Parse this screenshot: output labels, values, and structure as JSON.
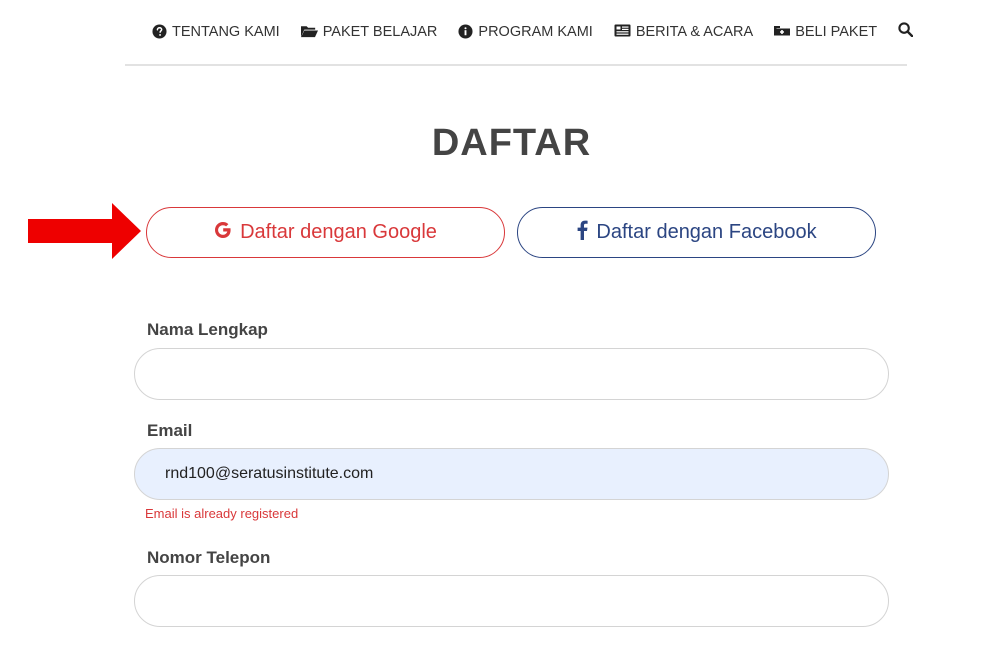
{
  "nav": {
    "items": [
      {
        "label": "TENTANG KAMI",
        "icon": "question-circle-icon"
      },
      {
        "label": "PAKET BELAJAR",
        "icon": "folder-open-icon"
      },
      {
        "label": "PROGRAM KAMI",
        "icon": "info-circle-icon"
      },
      {
        "label": "BERITA & ACARA",
        "icon": "newspaper-icon"
      },
      {
        "label": "BELI PAKET",
        "icon": "cart-plus-icon"
      }
    ],
    "search_icon": "search-icon"
  },
  "page": {
    "title": "DAFTAR"
  },
  "social": {
    "google_label": "Daftar dengan Google",
    "facebook_label": "Daftar dengan Facebook",
    "google_color": "#d9383a",
    "facebook_color": "#2b4582"
  },
  "annotation": {
    "arrow_color": "#ee0000"
  },
  "form": {
    "full_name": {
      "label": "Nama Lengkap",
      "value": ""
    },
    "email": {
      "label": "Email",
      "value": "rnd100@seratusinstitute.com",
      "error": "Email is already registered"
    },
    "phone": {
      "label": "Nomor Telepon",
      "value": ""
    }
  }
}
